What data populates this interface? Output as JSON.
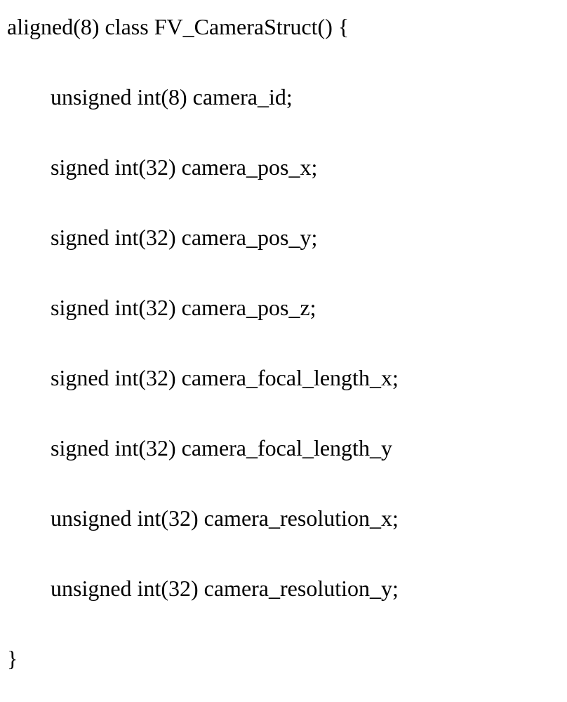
{
  "code": {
    "line0": "aligned(8) class FV_CameraStruct() {",
    "line1": "unsigned int(8) camera_id;",
    "line2": "signed int(32) camera_pos_x;",
    "line3": "signed int(32) camera_pos_y;",
    "line4": "signed int(32) camera_pos_z;",
    "line5": "signed int(32) camera_focal_length_x;",
    "line6": "signed int(32) camera_focal_length_y",
    "line7": "unsigned int(32) camera_resolution_x;",
    "line8": "unsigned int(32) camera_resolution_y;",
    "line9": "}"
  }
}
